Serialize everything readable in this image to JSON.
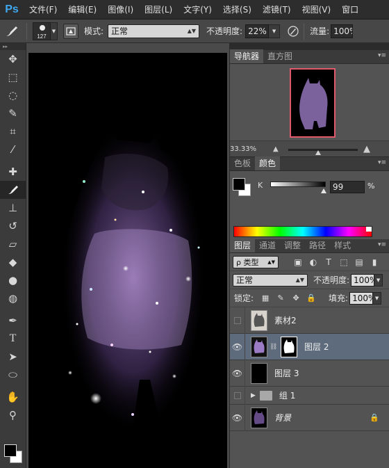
{
  "app": {
    "logo": "Ps"
  },
  "menubar": {
    "items": [
      "文件(F)",
      "编辑(E)",
      "图像(I)",
      "图层(L)",
      "文字(Y)",
      "选择(S)",
      "滤镜(T)",
      "视图(V)",
      "窗口"
    ]
  },
  "options": {
    "brush_size": "127",
    "mode_label": "模式:",
    "mode_value": "正常",
    "opacity_label": "不透明度:",
    "opacity_value": "22%",
    "flow_label": "流量:",
    "flow_value": "100%"
  },
  "navigator": {
    "tabs": [
      "导航器",
      "直方图"
    ],
    "zoom": "33.33%"
  },
  "color_panel": {
    "tabs": [
      "色板",
      "颜色"
    ],
    "channel_label": "K",
    "channel_value": "99",
    "unit": "%"
  },
  "layers_panel": {
    "tabs": [
      "图层",
      "通道",
      "调整",
      "路径",
      "样式"
    ],
    "filter_label": "ρ 类型",
    "blend_mode": "正常",
    "opacity_label": "不透明度:",
    "opacity_value": "100%",
    "lock_label": "锁定:",
    "fill_label": "填充:",
    "fill_value": "100%",
    "layers": [
      {
        "name": "素材2",
        "visible": false
      },
      {
        "name": "图层 2",
        "visible": true,
        "selected": true
      },
      {
        "name": "图层 3",
        "visible": true
      },
      {
        "name": "组 1",
        "visible": false
      },
      {
        "name": "背景",
        "visible": true,
        "locked": true
      }
    ]
  },
  "colors": {
    "accent": "#3ea8f0",
    "selected_layer": "#5d6b7c",
    "nav_frame": "#e05a6b"
  }
}
